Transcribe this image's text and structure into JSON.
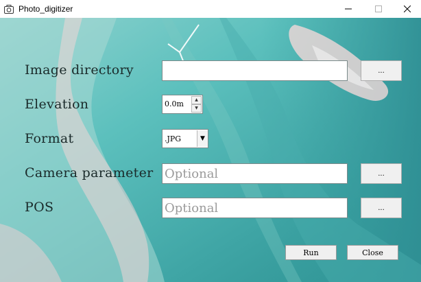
{
  "window": {
    "title": "Photo_digitizer",
    "minimize_glyph": "—",
    "maximize_glyph": "☐",
    "close_glyph": "✕"
  },
  "form": {
    "image_directory": {
      "label": "Image directory",
      "value": "",
      "browse_label": "..."
    },
    "elevation": {
      "label": "Elevation",
      "value": "0.0m",
      "up_glyph": "▲",
      "down_glyph": "▼"
    },
    "format": {
      "label": "Format",
      "selected": ".JPG",
      "arrow_glyph": "▼"
    },
    "camera_parameter": {
      "label": "Camera parameter",
      "placeholder": "Optional",
      "browse_label": "..."
    },
    "pos": {
      "label": "POS",
      "placeholder": "Optional",
      "browse_label": "..."
    }
  },
  "actions": {
    "run_label": "Run",
    "close_label": "Close"
  },
  "colors": {
    "ocean_light": "#8fd3cf",
    "ocean_mid": "#4fb3b0",
    "ocean_dark": "#2b8f90",
    "foam": "#f2d9d9"
  }
}
